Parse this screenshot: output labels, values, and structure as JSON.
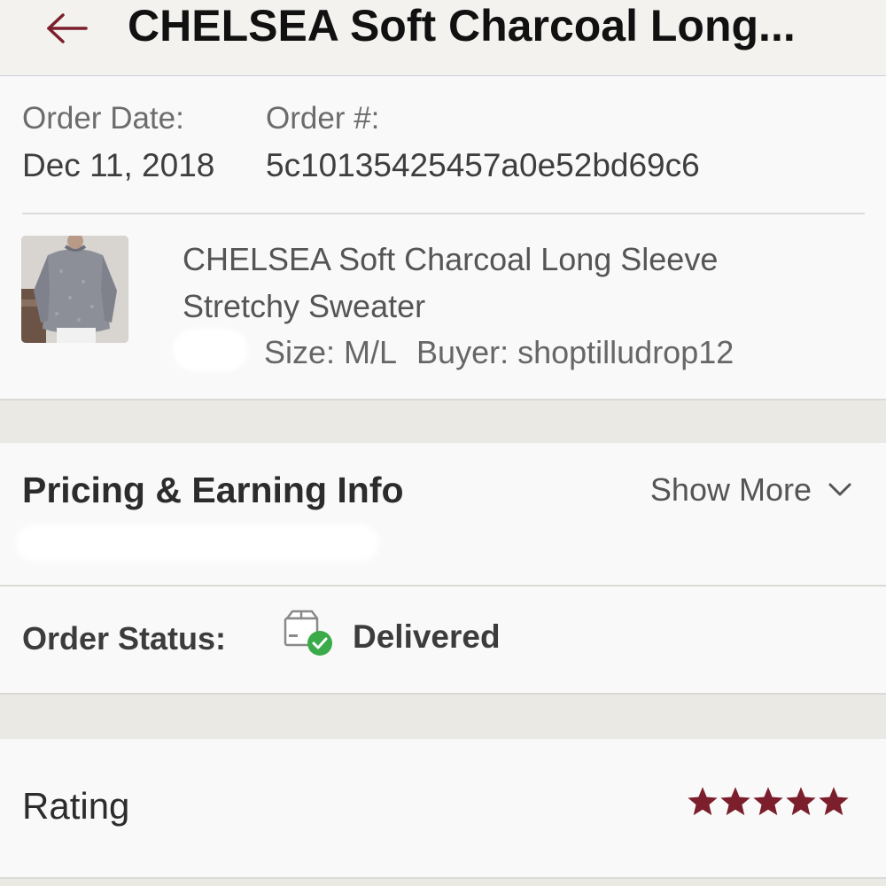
{
  "header": {
    "title": "CHELSEA Soft Charcoal Long..."
  },
  "order": {
    "date_label": "Order Date:",
    "date_value": "Dec 11, 2018",
    "number_label": "Order #:",
    "number_value": "5c10135425457a0e52bd69c6"
  },
  "item": {
    "title": "CHELSEA Soft Charcoal Long Sleeve Stretchy Sweater",
    "size": "Size: M/L",
    "buyer": "Buyer: shoptilludrop12"
  },
  "pricing": {
    "title": "Pricing & Earning Info",
    "show_more": "Show More"
  },
  "status": {
    "label": "Order Status:",
    "value": "Delivered"
  },
  "rating": {
    "label": "Rating",
    "stars": 5,
    "max": 5
  },
  "colors": {
    "accent": "#7a1f2b",
    "delivered_check": "#3bab4a"
  }
}
